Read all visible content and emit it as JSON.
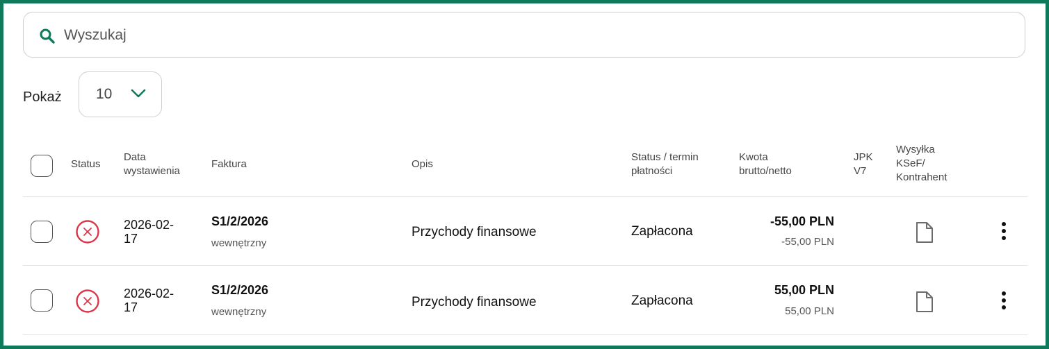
{
  "search": {
    "placeholder": "Wyszukaj",
    "value": ""
  },
  "show": {
    "label": "Pokaż",
    "value": "10"
  },
  "columns": {
    "status": "Status",
    "date_1": "Data",
    "date_2": "wystawienia",
    "invoice": "Faktura",
    "description": "Opis",
    "payment_1": "Status / termin",
    "payment_2": "płatności",
    "amount_1": "Kwota",
    "amount_2": "brutto/netto",
    "jpk_1": "JPK",
    "jpk_2": "V7",
    "ksef_1": "Wysyłka",
    "ksef_2": "KSeF/",
    "ksef_3": "Kontrahent"
  },
  "rows": [
    {
      "date_1": "2026-02-",
      "date_2": "17",
      "invoice_number": "S1/2/2026",
      "invoice_type": "wewnętrzny",
      "description": "Przychody finansowe",
      "payment_status": "Zapłacona",
      "gross": "-55,00 PLN",
      "net": "-55,00 PLN",
      "status_icon": "error-circle-icon"
    },
    {
      "date_1": "2026-02-",
      "date_2": "17",
      "invoice_number": "S1/2/2026",
      "invoice_type": "wewnętrzny",
      "description": "Przychody finansowe",
      "payment_status": "Zapłacona",
      "gross": "55,00 PLN",
      "net": "55,00 PLN",
      "status_icon": "error-circle-icon"
    }
  ],
  "colors": {
    "accent": "#0f7a5c",
    "error": "#d9364a"
  }
}
